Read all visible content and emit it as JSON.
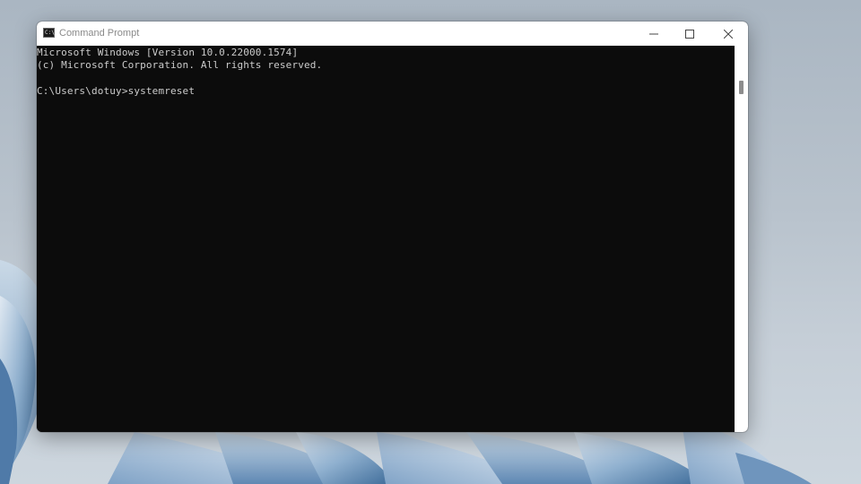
{
  "window": {
    "title": "Command Prompt",
    "app_icon": "cmd-icon",
    "controls": {
      "minimize_icon": "minimize-icon",
      "maximize_icon": "maximize-icon",
      "close_icon": "close-icon"
    }
  },
  "terminal": {
    "lines": [
      "Microsoft Windows [Version 10.0.22000.1574]",
      "(c) Microsoft Corporation. All rights reserved.",
      "",
      "C:\\Users\\dotuy>systemreset"
    ],
    "text_color": "#cccccc",
    "background_color": "#0c0c0c"
  }
}
